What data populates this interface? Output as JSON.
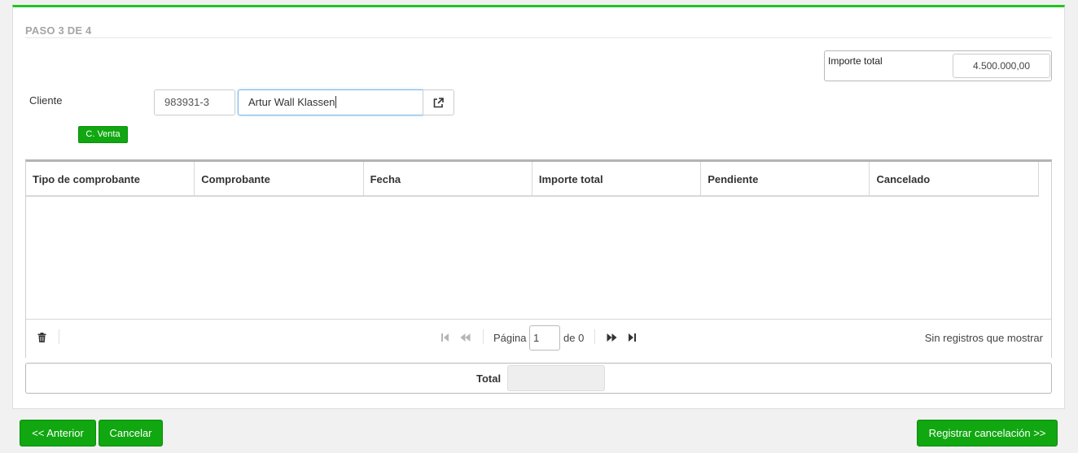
{
  "step": {
    "title": "PASO 3 DE 4"
  },
  "importe_total": {
    "label": "Importe total",
    "value": "4.500.000,00"
  },
  "cliente": {
    "label": "Cliente",
    "code": "983931-3",
    "name": "Artur Wall Klassen",
    "open_icon": "external-link-icon",
    "badge": "C. Venta"
  },
  "grid": {
    "columns": [
      "Tipo de comprobante",
      "Comprobante",
      "Fecha",
      "Importe total",
      "Pendiente",
      "Cancelado"
    ],
    "rows": [],
    "footer": {
      "page_label": "Página",
      "page_value": "1",
      "of_label": "de 0",
      "empty_text": "Sin registros que mostrar",
      "delete_icon": "trash-icon"
    }
  },
  "summary": {
    "total_label": "Total",
    "total_value": ""
  },
  "actions": {
    "previous": "<< Anterior",
    "cancel": "Cancelar",
    "register": "Registrar cancelación >>"
  },
  "colors": {
    "accent": "#22c422",
    "button": "#10a710",
    "focus": "#7eb6e8"
  }
}
